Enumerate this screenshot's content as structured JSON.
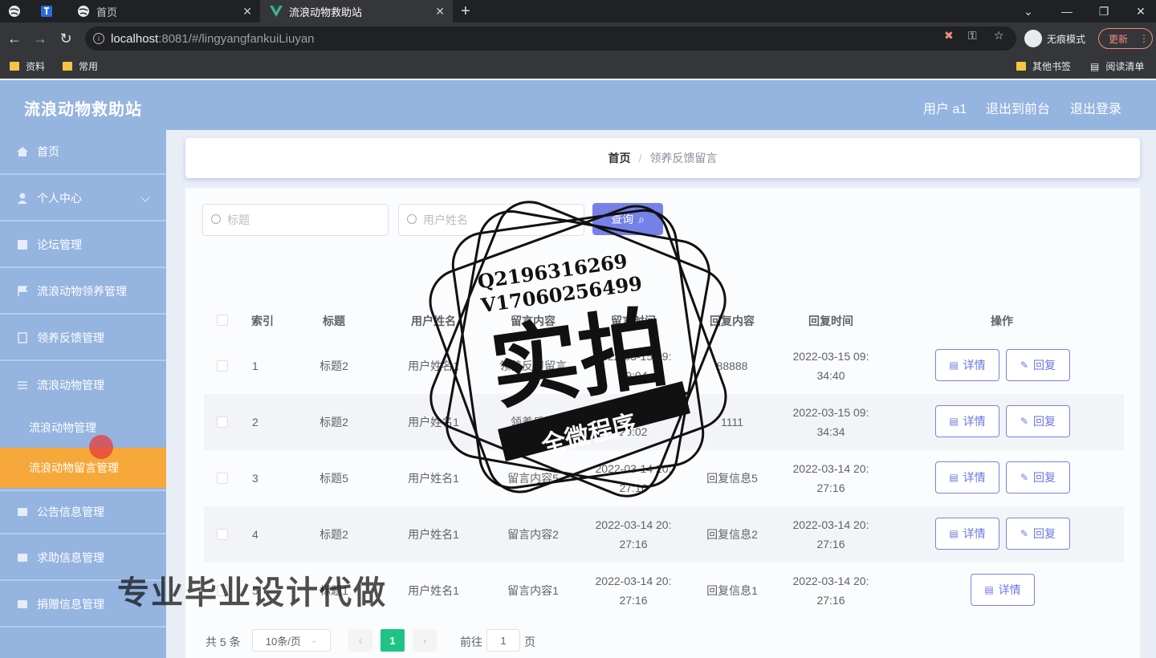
{
  "browser": {
    "tabs": [
      {
        "label": ""
      },
      {
        "label": ""
      },
      {
        "label": "首页"
      },
      {
        "label": "流浪动物救助站"
      }
    ],
    "url_host": "localhost",
    "url_rest": ":8081/#/lingyangfankuiLiuyan",
    "profile_label": "无痕模式",
    "update_label": "更新",
    "bookmarks": [
      "资料",
      "常用"
    ],
    "bookmarks_right": [
      "其他书签",
      "阅读清单"
    ]
  },
  "header": {
    "title": "流浪动物救助站",
    "links": [
      "用户 a1",
      "退出到前台",
      "退出登录"
    ]
  },
  "sidebar": {
    "items": [
      {
        "label": "首页",
        "icon": "home-icon"
      },
      {
        "label": "个人中心",
        "icon": "user-icon"
      },
      {
        "label": "论坛管理",
        "icon": "forum-icon"
      },
      {
        "label": "流浪动物领养管理",
        "icon": "flag-icon"
      },
      {
        "label": "领养反馈管理",
        "icon": "document-icon"
      },
      {
        "label": "流浪动物管理",
        "icon": "list-icon"
      },
      {
        "label": "公告信息管理",
        "icon": "notice-icon"
      },
      {
        "label": "求助信息管理",
        "icon": "help-icon"
      },
      {
        "label": "捐赠信息管理",
        "icon": "donate-icon"
      }
    ],
    "submenu": [
      "流浪动物管理",
      "流浪动物留言管理"
    ]
  },
  "breadcrumb": {
    "home": "首页",
    "separator": "/",
    "current": "领养反馈留言"
  },
  "search": {
    "title_placeholder": "标题",
    "username_placeholder": "用户姓名",
    "query_label": "查询"
  },
  "table": {
    "headers": [
      "索引",
      "标题",
      "用户姓名",
      "留言内容",
      "留言时间",
      "回复内容",
      "回复时间",
      "操作"
    ],
    "rows": [
      {
        "index": "1",
        "title": "标题2",
        "user": "用户姓名1",
        "content": "领养反馈留言",
        "time1": "2022-03-15 09:",
        "time2": "29:04",
        "reply": "88888",
        "rtime1": "2022-03-15 09:",
        "rtime2": "34:40",
        "can_reply": true
      },
      {
        "index": "2",
        "title": "标题2",
        "user": "用户姓名1",
        "content": "领养反馈",
        "time1": "2022-03-15 09:",
        "time2": "29:02",
        "reply": "1111",
        "rtime1": "2022-03-15 09:",
        "rtime2": "34:34",
        "can_reply": true
      },
      {
        "index": "3",
        "title": "标题5",
        "user": "用户姓名1",
        "content": "留言内容5",
        "time1": "2022-03-14 20:",
        "time2": "27:16",
        "reply": "回复信息5",
        "rtime1": "2022-03-14 20:",
        "rtime2": "27:16",
        "can_reply": true
      },
      {
        "index": "4",
        "title": "标题2",
        "user": "用户姓名1",
        "content": "留言内容2",
        "time1": "2022-03-14 20:",
        "time2": "27:16",
        "reply": "回复信息2",
        "rtime1": "2022-03-14 20:",
        "rtime2": "27:16",
        "can_reply": true
      },
      {
        "index": "5",
        "title": "标题1",
        "user": "用户姓名1",
        "content": "留言内容1",
        "time1": "2022-03-14 20:",
        "time2": "27:16",
        "reply": "回复信息1",
        "rtime1": "2022-03-14 20:",
        "rtime2": "27:16",
        "can_reply": false
      }
    ],
    "detail_label": "详情",
    "reply_label": "回复"
  },
  "pagination": {
    "total": "共 5 条",
    "page_size": "10条/页",
    "current": "1",
    "goto_prefix": "前往",
    "goto_value": "1",
    "goto_suffix": "页"
  },
  "watermark": {
    "line1": "Q2196316269",
    "line2": "V17060256499",
    "big": "实拍",
    "ribbon": "全微程序",
    "bottom_text": "专业毕业设计代做"
  }
}
